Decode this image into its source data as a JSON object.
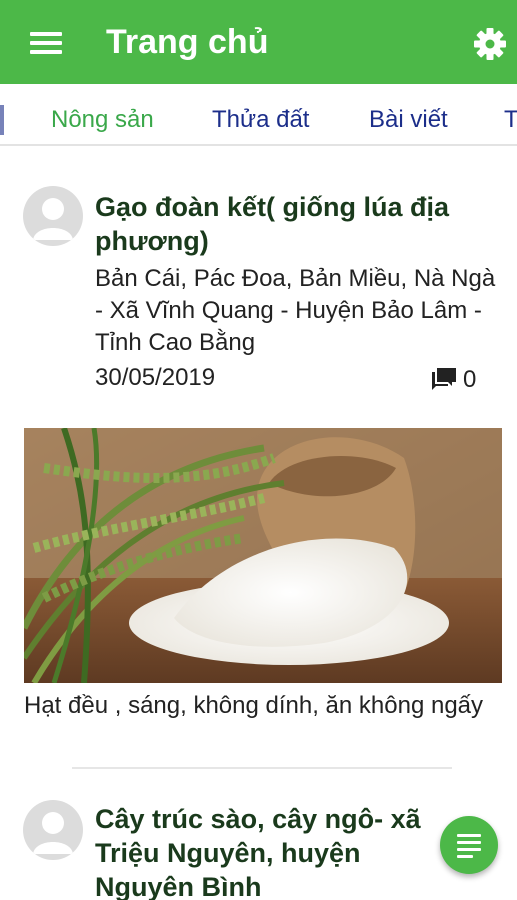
{
  "app_bar": {
    "title": "Trang chủ",
    "background": "#4cb848",
    "menu_icon": "hamburger-menu-icon",
    "settings_icon": "gear-icon"
  },
  "tabs": [
    {
      "label": "Nông sản",
      "active": true
    },
    {
      "label": "Thửa đất",
      "active": false
    },
    {
      "label": "Bài viết",
      "active": false
    },
    {
      "label": "T",
      "active": false
    }
  ],
  "posts": [
    {
      "title": "Gạo đoàn kết( giống lúa địa phương)",
      "location": "Bản Cái, Pác Đoa, Bản Miều, Nà Ngà - Xã Vĩnh Quang - Huyện Bảo Lâm - Tỉnh Cao Bằng",
      "date": "30/05/2019",
      "comments": "0",
      "caption": "Hạt đều , sáng, không dính, ăn không ngấy"
    },
    {
      "title": "Cây trúc sào, cây ngô- xã Triệu Nguyên, huyện Nguyên Bình"
    }
  ],
  "fab_icon": "list-icon"
}
